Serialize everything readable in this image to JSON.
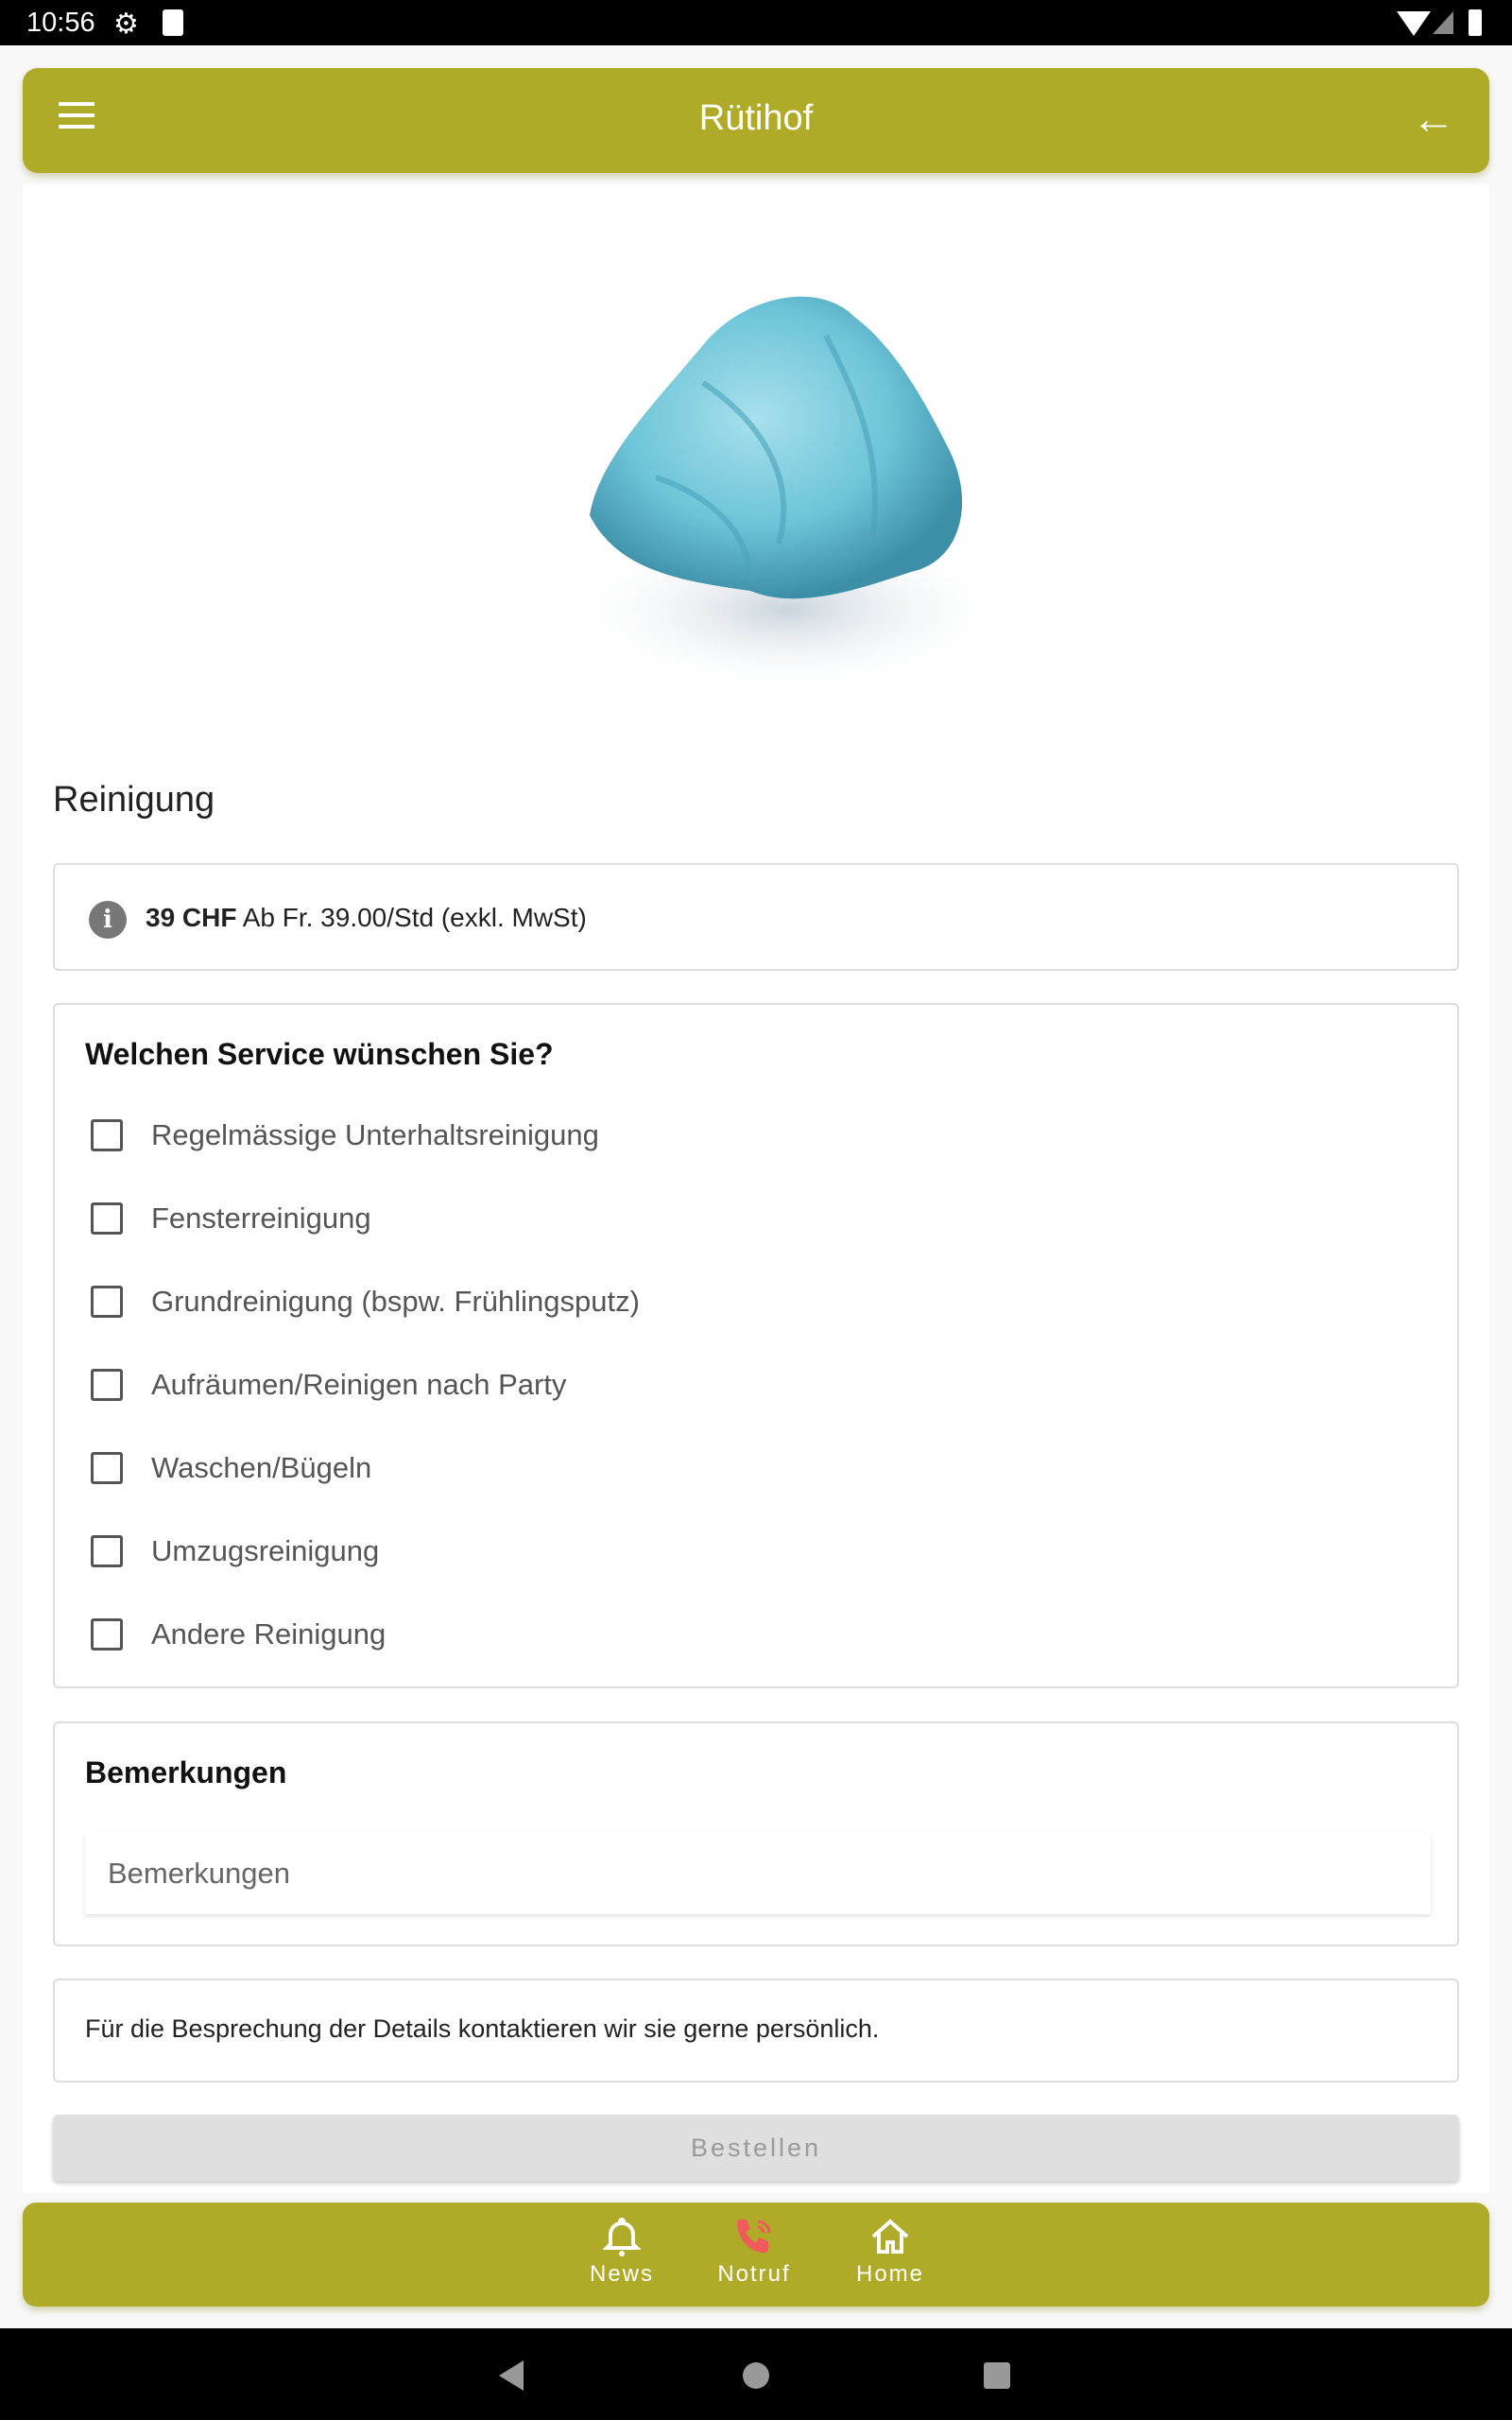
{
  "status_bar": {
    "time": "10:56"
  },
  "app_bar": {
    "title": "Rütihof"
  },
  "page": {
    "title": "Reinigung"
  },
  "price": {
    "amount": "39 CHF",
    "description": "Ab Fr. 39.00/Std (exkl. MwSt)"
  },
  "service": {
    "heading": "Welchen Service wünschen Sie?",
    "options": [
      {
        "label": "Regelmässige Unterhaltsreinigung",
        "checked": false
      },
      {
        "label": "Fensterreinigung",
        "checked": false
      },
      {
        "label": "Grundreinigung (bspw. Frühlingsputz)",
        "checked": false
      },
      {
        "label": "Aufräumen/Reinigen nach Party",
        "checked": false
      },
      {
        "label": "Waschen/Bügeln",
        "checked": false
      },
      {
        "label": "Umzugsreinigung",
        "checked": false
      },
      {
        "label": "Andere Reinigung",
        "checked": false
      }
    ]
  },
  "remarks": {
    "heading": "Bemerkungen",
    "placeholder": "Bemerkungen",
    "value": ""
  },
  "contact_note": "Für die Besprechung der Details kontaktieren wir sie gerne persönlich.",
  "order_button": "Bestellen",
  "bottom_nav": {
    "items": [
      {
        "label": "News",
        "icon": "bell-icon"
      },
      {
        "label": "Notruf",
        "icon": "phone-icon"
      },
      {
        "label": "Home",
        "icon": "home-icon"
      }
    ]
  },
  "colors": {
    "brand": "#afab28",
    "emergency": "#f05a5a"
  }
}
